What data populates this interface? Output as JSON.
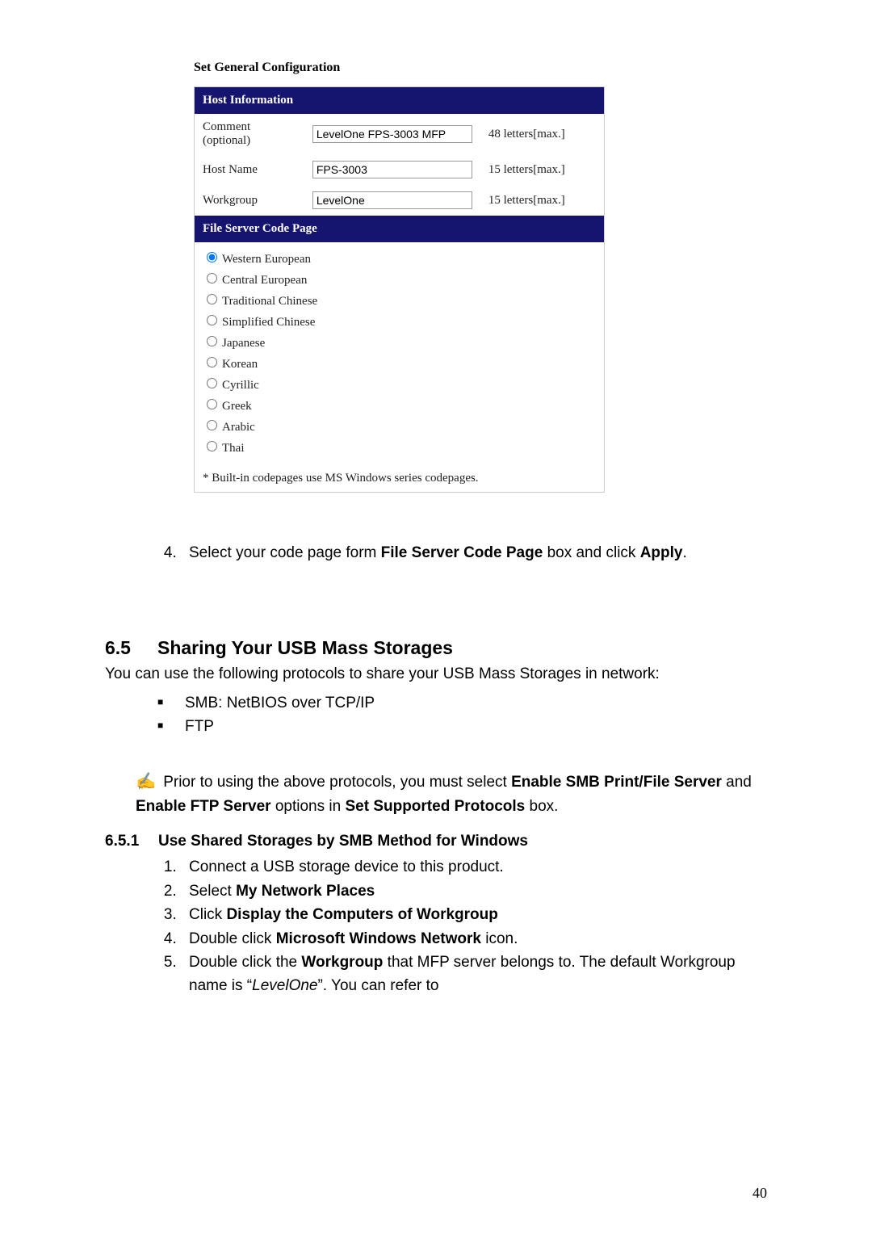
{
  "screenshot": {
    "title": "Set General Configuration",
    "host_info_header": "Host Information",
    "rows": [
      {
        "label": "Comment (optional)",
        "value": "LevelOne FPS-3003 MFP",
        "hint": "48 letters[max.]"
      },
      {
        "label": "Host Name",
        "value": "FPS-3003",
        "hint": "15 letters[max.]"
      },
      {
        "label": "Workgroup",
        "value": "LevelOne",
        "hint": "15 letters[max.]"
      }
    ],
    "codepage_header": "File Server Code Page",
    "codepages": [
      "Western European",
      "Central European",
      "Traditional Chinese",
      "Simplified Chinese",
      "Japanese",
      "Korean",
      "Cyrillic",
      "Greek",
      "Arabic",
      "Thai"
    ],
    "codepage_selected_index": 0,
    "footnote": "* Built-in codepages use MS Windows series codepages."
  },
  "step4": {
    "pre": "Select your code page form ",
    "b1": "File Server Code Page",
    "mid": " box and click ",
    "b2": "Apply",
    "post": "."
  },
  "sec65": {
    "num": "6.5",
    "title": "Sharing Your USB Mass Storages",
    "intro": "You can use the following protocols to share your USB Mass Storages in network:",
    "bullets": [
      "SMB: NetBIOS over TCP/IP",
      "FTP"
    ]
  },
  "note": {
    "p1a": "Prior to using the above protocols, you must select ",
    "b1": "Enable SMB Print/File Server",
    "p1b": " and ",
    "b2": "Enable FTP Server",
    "p1c": " options in ",
    "b3": "Set Supported Protocols",
    "p1d": " box."
  },
  "sec651": {
    "num": "6.5.1",
    "title": "Use Shared Storages by SMB Method for Windows",
    "steps": {
      "s1": "Connect a USB storage device to this product.",
      "s2a": "Select ",
      "s2b": "My Network Places",
      "s3a": "Click ",
      "s3b": "Display the Computers of Workgroup",
      "s4a": "Double click ",
      "s4b": "Microsoft Windows Network",
      "s4c": " icon.",
      "s5a": "Double click the ",
      "s5b": "Workgroup",
      "s5c": " that MFP server belongs to. The default Workgroup name is “",
      "s5d": "LevelOne",
      "s5e": "”. You can refer to"
    }
  },
  "page_number": "40"
}
